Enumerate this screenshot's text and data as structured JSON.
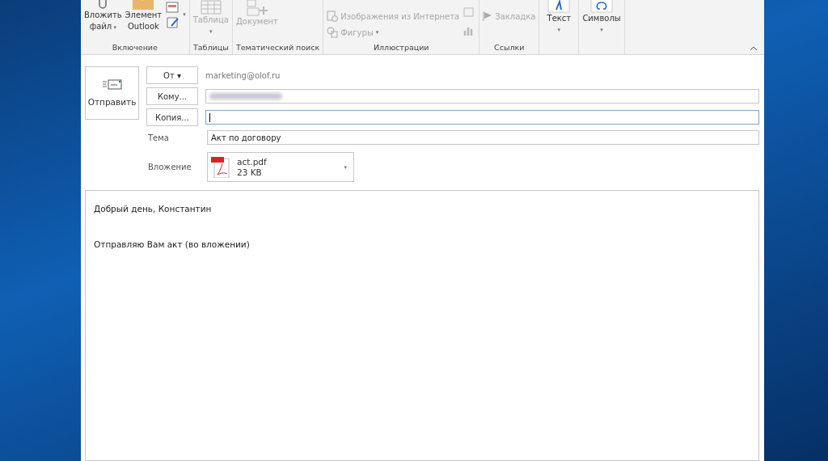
{
  "ribbon": {
    "groups": [
      {
        "label": "Включение",
        "items": [
          {
            "kind": "big",
            "label": "Вложить",
            "label2": "файл",
            "caret": "▾",
            "disabled": false
          },
          {
            "kind": "big",
            "label": "Элемент",
            "label2": "Outlook",
            "disabled": false
          },
          {
            "kind": "smallstack",
            "caret": "▾",
            "disabled": false
          }
        ]
      },
      {
        "label": "Таблицы",
        "items": [
          {
            "kind": "big",
            "label": "Таблица",
            "caret": "▾",
            "disabled": true
          }
        ]
      },
      {
        "label": "Тематический поиск",
        "items": [
          {
            "kind": "big",
            "label": "Документ",
            "disabled": true
          }
        ]
      },
      {
        "label": "Иллюстрации",
        "items": [
          {
            "kind": "list",
            "rows": [
              {
                "label": "Изображения из Интернета"
              },
              {
                "label": "Фигуры",
                "caret": "▾"
              }
            ],
            "disabled": true
          },
          {
            "kind": "smallstack",
            "disabled": true
          }
        ]
      },
      {
        "label": "Ссылки",
        "items": [
          {
            "kind": "list",
            "rows": [
              {
                "label": "Закладка"
              }
            ],
            "disabled": true
          }
        ]
      },
      {
        "items": [
          {
            "kind": "big",
            "label": "Текст",
            "caret": "▾",
            "disabled": false
          }
        ]
      },
      {
        "items": [
          {
            "kind": "big",
            "label": "Символы",
            "caret": "▾",
            "disabled": false
          }
        ]
      }
    ]
  },
  "compose": {
    "send_label": "Отправить",
    "from_label": "От",
    "from_caret": "▾",
    "from_value": "marketing@olof.ru",
    "to_label": "Кому...",
    "cc_label": "Копия...",
    "cc_focused": true,
    "subject_label": "Тема",
    "subject_value": "Акт по договору",
    "attachment_label": "Вложение",
    "attachment": {
      "name": "act.pdf",
      "size": "23 KB",
      "caret": "▾"
    }
  },
  "body": {
    "paragraphs": [
      "Добрый день, Константин",
      "Отправляю Вам акт (во вложении)"
    ]
  }
}
